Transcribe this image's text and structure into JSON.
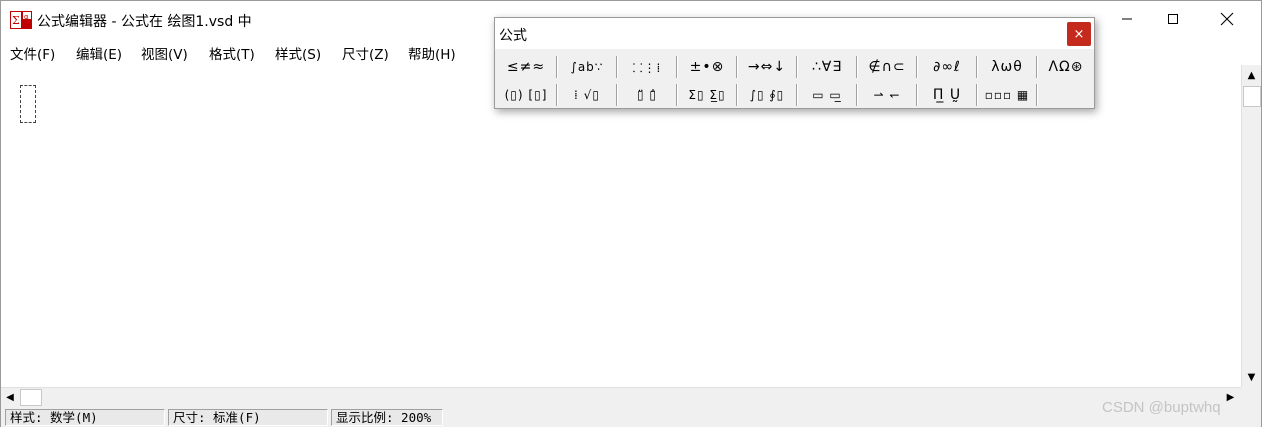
{
  "window": {
    "title": "公式编辑器 - 公式在 绘图1.vsd 中",
    "icon": "equation-editor-icon"
  },
  "menu": [
    {
      "label": "文件(F)"
    },
    {
      "label": "编辑(E)"
    },
    {
      "label": "视图(V)"
    },
    {
      "label": "格式(T)"
    },
    {
      "label": "样式(S)"
    },
    {
      "label": "尺寸(Z)"
    },
    {
      "label": "帮助(H)"
    }
  ],
  "palette": {
    "title": "公式",
    "close_glyph": "×",
    "row1": [
      {
        "glyph": "≤≠≈"
      },
      {
        "glyph": "∫ab∵"
      },
      {
        "glyph": "⸬⋮⁞"
      },
      {
        "glyph": "±•⊗"
      },
      {
        "glyph": "→⇔↓"
      },
      {
        "glyph": "∴∀∃"
      },
      {
        "glyph": "∉∩⊂"
      },
      {
        "glyph": "∂∞ℓ"
      },
      {
        "glyph": "λωθ"
      },
      {
        "glyph": "ΛΩ⊛"
      }
    ],
    "row2": [
      {
        "glyph": "(▯) [▯]"
      },
      {
        "glyph": "⁞ √▯"
      },
      {
        "glyph": "▯̈ ▯̂"
      },
      {
        "glyph": "Σ▯ Σ̲▯"
      },
      {
        "glyph": "∫▯ ∮▯"
      },
      {
        "glyph": "▭ ▭̲"
      },
      {
        "glyph": "⇀ ↽"
      },
      {
        "glyph": "Π̲ Ṵ"
      },
      {
        "glyph": "▫▫▫ ▦"
      }
    ]
  },
  "statusbar": {
    "style": "样式: 数学(M)",
    "size": "尺寸: 标准(F)",
    "zoom": "显示比例: 200%"
  },
  "watermark": "CSDN @buptwhq"
}
